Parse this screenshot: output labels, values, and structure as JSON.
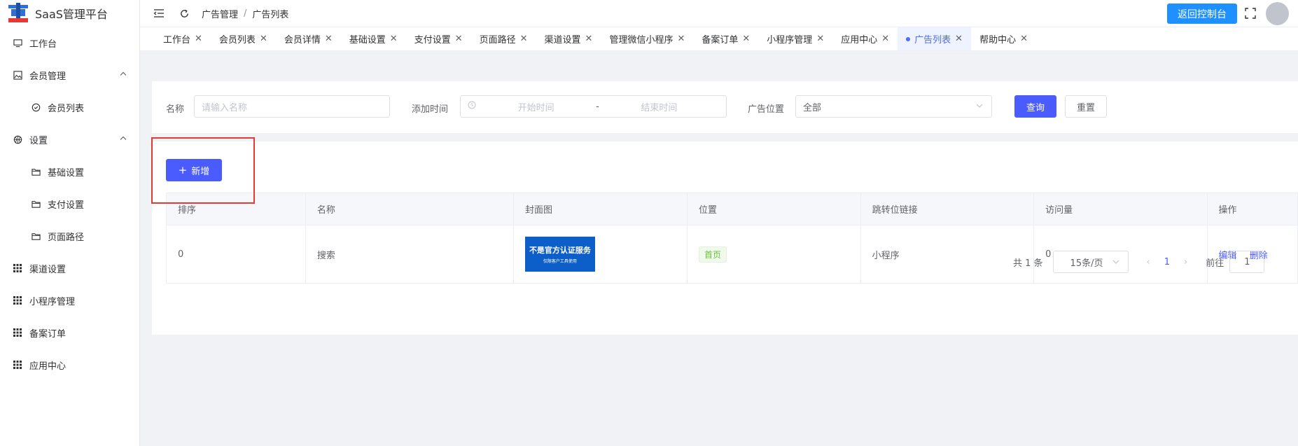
{
  "app": {
    "title": "SaaS管理平台"
  },
  "sidebar": {
    "items": [
      {
        "label": "工作台",
        "icon": "monitor-icon"
      },
      {
        "label": "会员管理",
        "icon": "picture-icon",
        "expanded": true
      },
      {
        "label": "会员列表",
        "icon": "check-circle-icon"
      },
      {
        "label": "设置",
        "icon": "basketball-icon",
        "expanded": true
      },
      {
        "label": "基础设置",
        "icon": "folder-icon"
      },
      {
        "label": "支付设置",
        "icon": "folder-icon"
      },
      {
        "label": "页面路径",
        "icon": "folder-icon"
      },
      {
        "label": "渠道设置",
        "icon": "grid-icon"
      },
      {
        "label": "小程序管理",
        "icon": "grid-icon"
      },
      {
        "label": "备案订单",
        "icon": "grid-icon"
      },
      {
        "label": "应用中心",
        "icon": "grid-icon"
      }
    ]
  },
  "header": {
    "breadcrumb": [
      "广告管理",
      "广告列表"
    ],
    "separator": "/",
    "back_button": "返回控制台"
  },
  "tabs": [
    {
      "label": "工作台"
    },
    {
      "label": "会员列表"
    },
    {
      "label": "会员详情"
    },
    {
      "label": "基础设置"
    },
    {
      "label": "支付设置"
    },
    {
      "label": "页面路径"
    },
    {
      "label": "渠道设置"
    },
    {
      "label": "管理微信小程序"
    },
    {
      "label": "备案订单"
    },
    {
      "label": "小程序管理"
    },
    {
      "label": "应用中心"
    },
    {
      "label": "广告列表",
      "active": true
    },
    {
      "label": "帮助中心"
    }
  ],
  "search": {
    "name_label": "名称",
    "name_placeholder": "请输入名称",
    "time_label": "添加时间",
    "start_placeholder": "开始时间",
    "range_sep": "-",
    "end_placeholder": "结束时间",
    "position_label": "广告位置",
    "position_value": "全部",
    "query_button": "查询",
    "reset_button": "重置"
  },
  "toolbar": {
    "add_button": "新增"
  },
  "table": {
    "columns": [
      "排序",
      "名称",
      "封面图",
      "位置",
      "跳转位链接",
      "访问量",
      "操作"
    ],
    "rows": [
      {
        "order": "0",
        "name": "搜索",
        "cover_title": "不是官方认证服务",
        "cover_sub": "仅限客户工具使用",
        "position": "首页",
        "link": "小程序",
        "visits": "0",
        "actions": [
          "编辑",
          "删除"
        ]
      }
    ]
  },
  "pagination": {
    "total": "共 1 条",
    "page_size": "15条/页",
    "current_page": "1",
    "goto_label": "前往",
    "goto_value": "1"
  },
  "colors": {
    "primary": "#4b5cff",
    "back_button": "#1e90ff",
    "highlight_box": "#e53935",
    "tag_green": "#67c23a"
  }
}
